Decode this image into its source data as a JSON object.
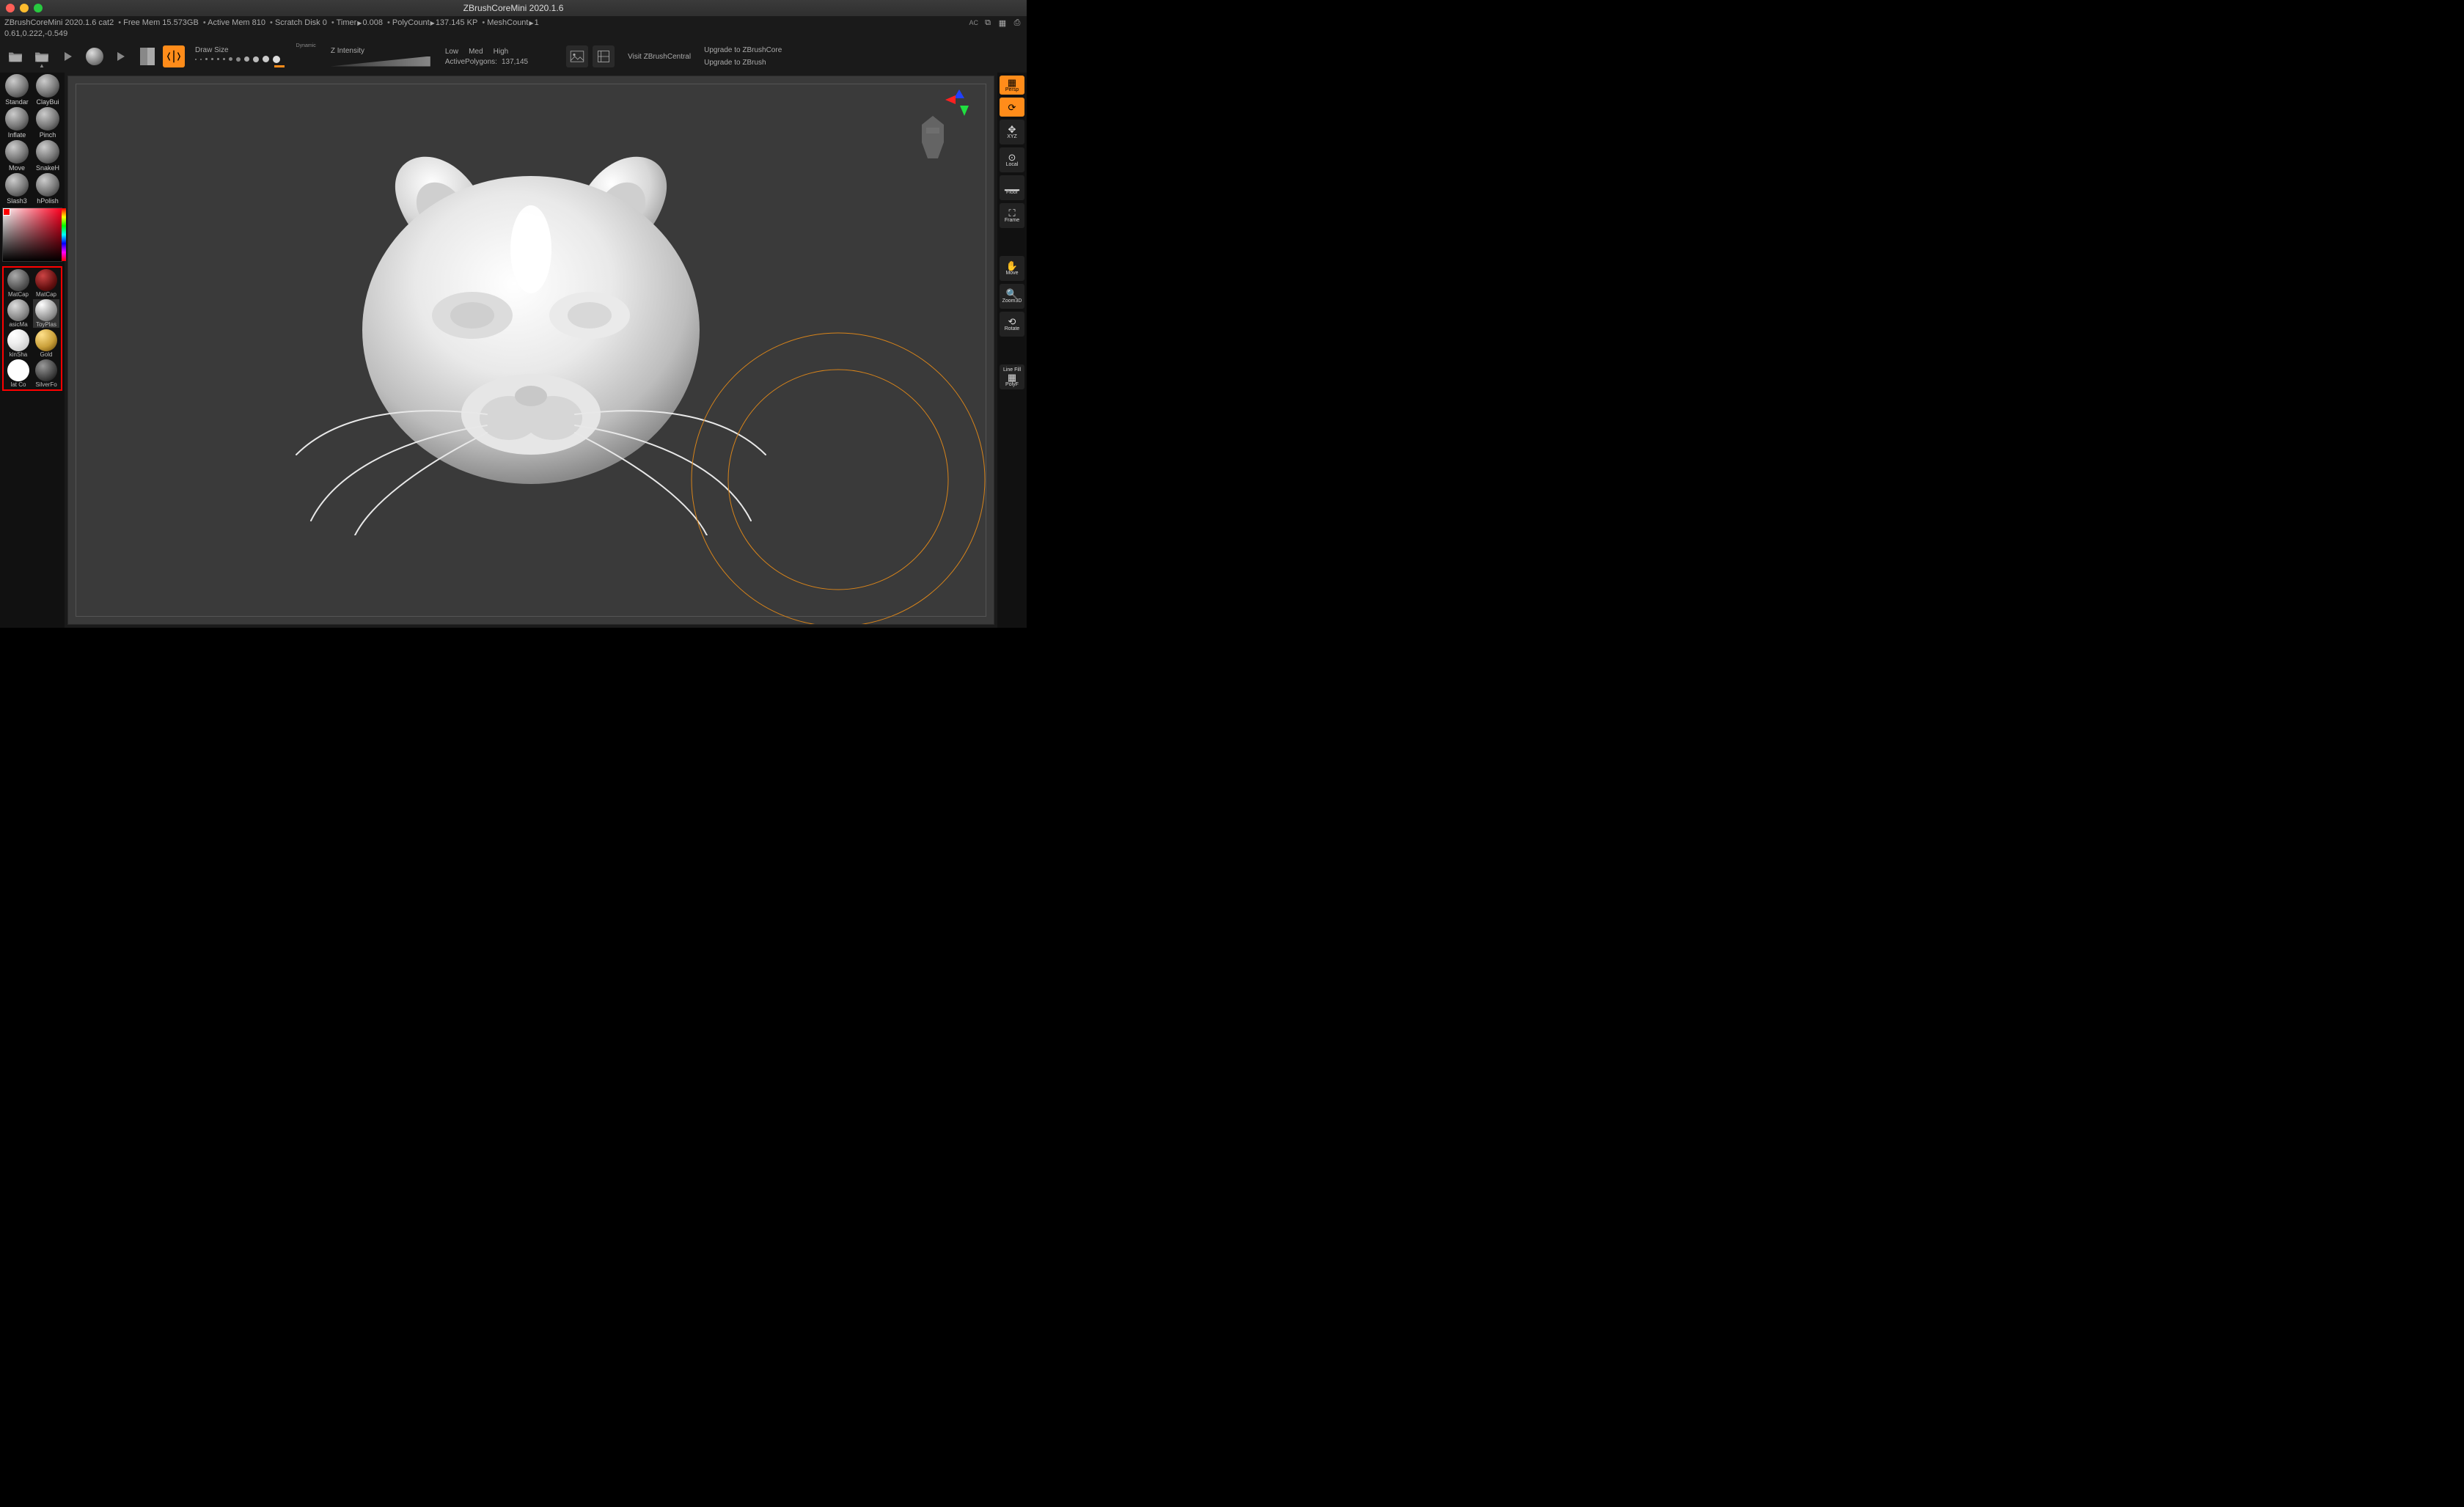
{
  "window": {
    "title": "ZBrushCoreMini 2020.1.6"
  },
  "info": {
    "app_doc": "ZBrushCoreMini 2020.1.6 cat2",
    "free_mem": "Free Mem 15.573GB",
    "active_mem": "Active Mem 810",
    "scratch": "Scratch Disk 0",
    "timer": "Timer",
    "timer_val": "0.008",
    "polycount": "PolyCount",
    "polycount_val": "137.145 KP",
    "meshcount": "MeshCount",
    "meshcount_val": "1",
    "ac": "AC"
  },
  "coords": "0.61,0.222,-0.549",
  "toolbar": {
    "draw_size": "Draw Size",
    "dynamic": "Dynamic",
    "z_intensity": "Z Intensity",
    "low": "Low",
    "med": "Med",
    "high": "High",
    "active_poly_label": "ActivePolygons:",
    "active_poly_val": "137,145",
    "visit": "Visit ZBrushCentral",
    "upgrade_core": "Upgrade to ZBrushCore",
    "upgrade_full": "Upgrade to ZBrush"
  },
  "brushes": [
    {
      "name": "Standar"
    },
    {
      "name": "ClayBui"
    },
    {
      "name": "Inflate"
    },
    {
      "name": "Pinch"
    },
    {
      "name": "Move"
    },
    {
      "name": "SnakeH"
    },
    {
      "name": "Slash3"
    },
    {
      "name": "hPolish"
    }
  ],
  "materials": [
    {
      "name": "MatCap",
      "cls": "m-grey"
    },
    {
      "name": "MatCap",
      "cls": "m-red"
    },
    {
      "name": "asicMa",
      "cls": "m-basic"
    },
    {
      "name": "ToyPlas",
      "cls": "m-toy"
    },
    {
      "name": "kinSha",
      "cls": "m-skin"
    },
    {
      "name": "Gold",
      "cls": "m-gold"
    },
    {
      "name": "lat Co",
      "cls": "m-flat"
    },
    {
      "name": "SilverFo",
      "cls": "m-silver"
    }
  ],
  "right": {
    "persp": "Persp",
    "xyz": "XYZ",
    "local": "Local",
    "floor": "Floor",
    "frame": "Frame",
    "move": "Move",
    "zoom": "Zoom3D",
    "rotate": "Rotate",
    "linefill": "Line Fill",
    "polyf": "PolyF"
  }
}
